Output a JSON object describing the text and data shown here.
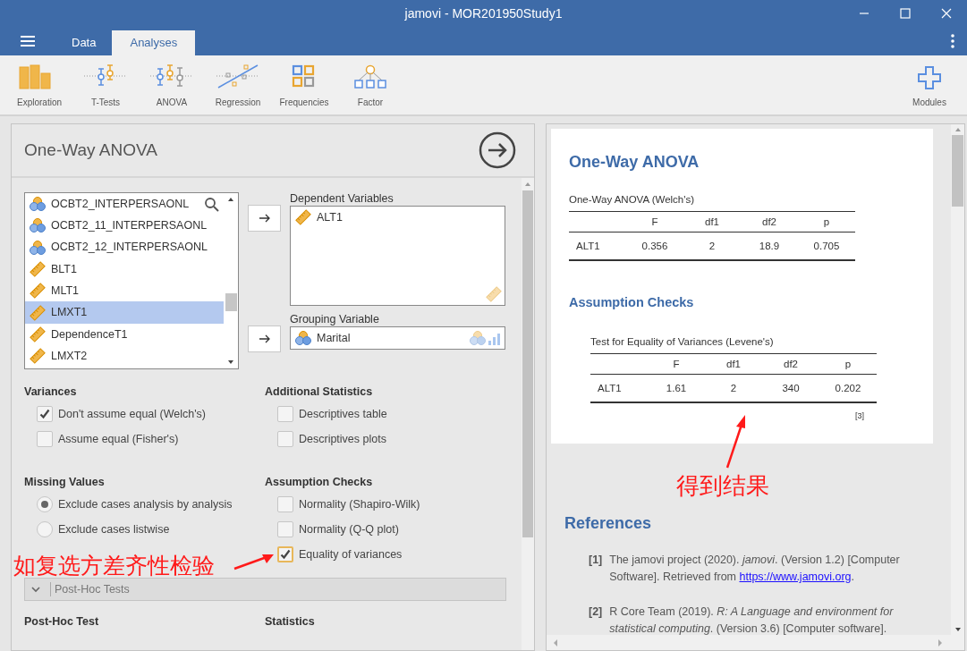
{
  "window": {
    "title": "jamovi - MOR201950Study1"
  },
  "tabs": [
    {
      "label": "Data",
      "selected": false
    },
    {
      "label": "Analyses",
      "selected": true
    }
  ],
  "ribbon": {
    "items": [
      {
        "label": "Exploration",
        "kind": "exploration"
      },
      {
        "label": "T-Tests",
        "kind": "ttests"
      },
      {
        "label": "ANOVA",
        "kind": "anova"
      },
      {
        "label": "Regression",
        "kind": "regression"
      },
      {
        "label": "Frequencies",
        "kind": "frequencies"
      },
      {
        "label": "Factor",
        "kind": "factor"
      }
    ],
    "modules": "Modules"
  },
  "analysis": {
    "title": "One-Way ANOVA",
    "variables": [
      {
        "name": "OCBT2_INTERPERSAONL",
        "kind": "nominal",
        "selected": false
      },
      {
        "name": "OCBT2_11_INTERPERSAONL",
        "kind": "nominal",
        "selected": false
      },
      {
        "name": "OCBT2_12_INTERPERSAONL",
        "kind": "nominal",
        "selected": false
      },
      {
        "name": "BLT1",
        "kind": "continuous",
        "selected": false
      },
      {
        "name": "MLT1",
        "kind": "continuous",
        "selected": false
      },
      {
        "name": "LMXT1",
        "kind": "continuous",
        "selected": true
      },
      {
        "name": "DependenceT1",
        "kind": "continuous",
        "selected": false
      },
      {
        "name": "LMXT2",
        "kind": "continuous",
        "selected": false
      }
    ],
    "dependent": {
      "label": "Dependent Variables",
      "items": [
        {
          "name": "ALT1",
          "kind": "continuous"
        }
      ]
    },
    "grouping": {
      "label": "Grouping Variable",
      "items": [
        {
          "name": "Marital",
          "kind": "nominal"
        }
      ]
    },
    "sections": [
      {
        "heading": "Variances",
        "options": [
          {
            "kind": "checkbox",
            "label": "Don't assume equal (Welch's)",
            "checked": true
          },
          {
            "kind": "checkbox",
            "label": "Assume equal (Fisher's)",
            "checked": false
          }
        ]
      },
      {
        "heading": "Additional Statistics",
        "options": [
          {
            "kind": "checkbox",
            "label": "Descriptives table",
            "checked": false
          },
          {
            "kind": "checkbox",
            "label": "Descriptives plots",
            "checked": false
          }
        ]
      },
      {
        "heading": "Missing Values",
        "options": [
          {
            "kind": "radio",
            "label": "Exclude cases analysis by analysis",
            "selected": true
          },
          {
            "kind": "radio",
            "label": "Exclude cases listwise",
            "selected": false
          }
        ]
      },
      {
        "heading": "Assumption Checks",
        "options": [
          {
            "kind": "checkbox",
            "label": "Normality (Shapiro-Wilk)",
            "checked": false
          },
          {
            "kind": "checkbox",
            "label": "Normality (Q-Q plot)",
            "checked": false
          },
          {
            "kind": "checkbox",
            "label": "Equality of variances",
            "checked": true,
            "focused": true
          }
        ]
      }
    ],
    "posthoc": {
      "label": "Post-Hoc Tests",
      "expanded": false
    },
    "bottom_headings": [
      "Post-Hoc Test",
      "Statistics"
    ]
  },
  "results": {
    "title": "One-Way ANOVA",
    "table_1": {
      "title": "One-Way ANOVA (Welch's)",
      "columns": [
        "F",
        "df1",
        "df2",
        "p"
      ],
      "rows": [
        {
          "name": "ALT1",
          "values": [
            "0.356",
            "2",
            "18.9",
            "0.705"
          ]
        }
      ]
    },
    "subheading": "Assumption Checks",
    "table_2": {
      "title": "Test for Equality of Variances (Levene's)",
      "columns": [
        "F",
        "df1",
        "df2",
        "p"
      ],
      "rows": [
        {
          "name": "ALT1",
          "values": [
            "1.61",
            "2",
            "340",
            "0.202"
          ]
        }
      ],
      "footnote": "[3]"
    },
    "references": {
      "title": "References",
      "items": [
        {
          "number": "[1]",
          "text": "The jamovi project (2020). *jamovi*. (Version 1.2) [Computer Software]. Retrieved from ",
          "link": "https://www.jamovi.org",
          "after": "."
        },
        {
          "number": "[2]",
          "text": "R Core Team (2019). *R: A Language and environment for statistical computing*. (Version 3.6) [Computer software]."
        }
      ]
    }
  },
  "annotations": [
    {
      "text": "如复选方差齐性检验"
    },
    {
      "text": "得到结果"
    }
  ]
}
